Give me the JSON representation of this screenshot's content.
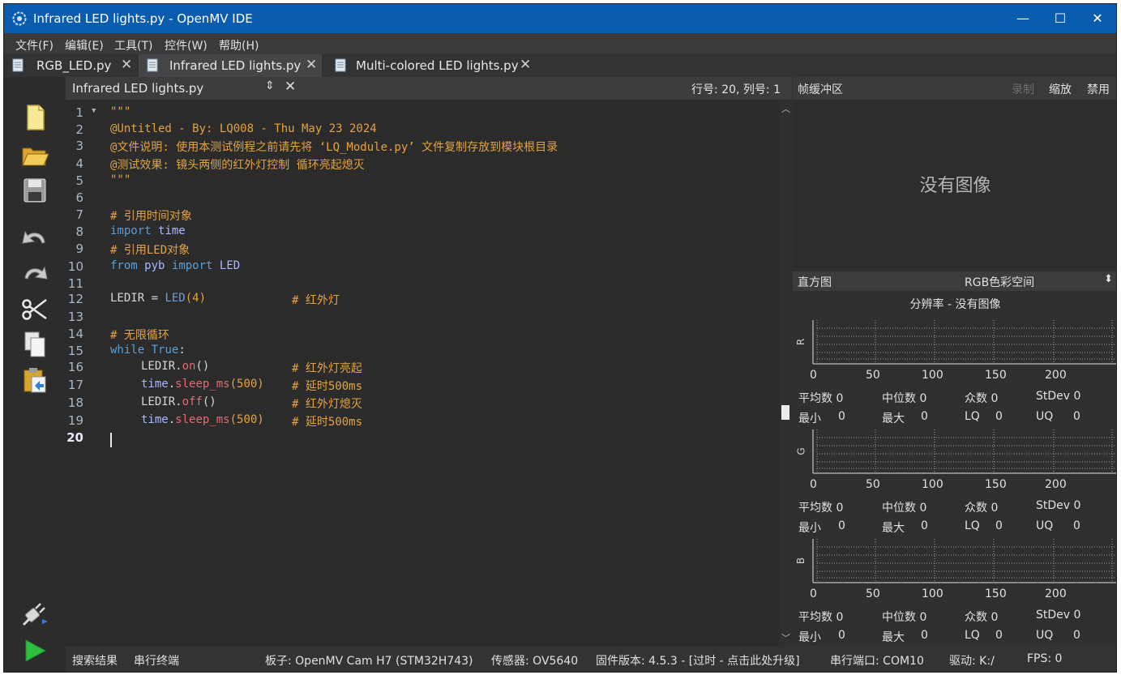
{
  "window": {
    "title": "Infrared LED lights.py - OpenMV IDE",
    "controls": {
      "minimize": "—",
      "maximize": "☐",
      "close": "✕"
    }
  },
  "menu": [
    "文件(F)",
    "编辑(E)",
    "工具(T)",
    "控件(W)",
    "帮助(H)"
  ],
  "tabs": [
    {
      "label": "RGB_LED.py",
      "close": "✕"
    },
    {
      "label": "Infrared LED lights.py",
      "close": "✕"
    },
    {
      "label": "Multi-colored LED lights.py",
      "close": "✕"
    }
  ],
  "editor_header": {
    "file": "Infrared LED lights.py",
    "updown": "⇕",
    "close": "✕",
    "position": "行号: 20, 列号: 1"
  },
  "code_lines": {
    "l1": "\"\"\"",
    "l2": "@Untitled - By: LQ008 - Thu May 23 2024",
    "l3": "@文件说明: 使用本测试例程之前请先将 ‘LQ_Module.py’ 文件复制存放到模块根目录",
    "l4": "@测试效果: 镜头两侧的红外灯控制 循环亮起熄灭",
    "l5": "\"\"\"",
    "l7": "# 引用时间对象",
    "l8_kw": "import",
    "l8_mod": "time",
    "l9": "# 引用LED对象",
    "l10_kw1": "from",
    "l10_mod": "pyb",
    "l10_kw2": "import",
    "l10_cls": "LED",
    "l12_var": "LEDIR = ",
    "l12_cls": "LED",
    "l12_arg": "(4)",
    "l12_cmt": "# 红外灯",
    "l14": "# 无限循环",
    "l15_kw": "while",
    "l15_val": "True",
    "l15_colon": ":",
    "l16_obj": "LEDIR.",
    "l16_fn": "on",
    "l16_paren": "()",
    "l16_cmt": "# 红外灯亮起",
    "l17_mod": "time",
    "l17_dot": ".",
    "l17_fn": "sleep_ms",
    "l17_arg": "(500)",
    "l17_cmt": "# 延时500ms",
    "l18_obj": "LEDIR.",
    "l18_fn": "off",
    "l18_paren": "()",
    "l18_cmt": "# 红外灯熄灭",
    "l19_mod": "time",
    "l19_dot": ".",
    "l19_fn": "sleep_ms",
    "l19_arg": "(500)",
    "l19_cmt": "# 延时500ms"
  },
  "line_numbers": [
    "1",
    "2",
    "3",
    "4",
    "5",
    "6",
    "7",
    "8",
    "9",
    "10",
    "11",
    "12",
    "13",
    "14",
    "15",
    "16",
    "17",
    "18",
    "19",
    "20"
  ],
  "framebuffer": {
    "title": "帧缓冲区",
    "record": "录制",
    "zoom": "缩放",
    "disable": "禁用",
    "no_image": "没有图像"
  },
  "histogram": {
    "title": "直方图",
    "colorspace": "RGB色彩空间",
    "resolution": "分辨率 - 没有图像",
    "ticks": [
      "0",
      "50",
      "100",
      "150",
      "200"
    ],
    "channels": [
      {
        "label": "R",
        "mean": "平均数 0",
        "median": "中位数 0",
        "mode": "众数 0",
        "stdev": "StDev 0",
        "min": "最小",
        "min_v": "0",
        "max": "最大",
        "max_v": "0",
        "lq": "LQ",
        "lq_v": "0",
        "uq": "UQ",
        "uq_v": "0"
      },
      {
        "label": "G",
        "mean": "平均数 0",
        "median": "中位数 0",
        "mode": "众数 0",
        "stdev": "StDev 0",
        "min": "最小",
        "min_v": "0",
        "max": "最大",
        "max_v": "0",
        "lq": "LQ",
        "lq_v": "0",
        "uq": "UQ",
        "uq_v": "0"
      },
      {
        "label": "B",
        "mean": "平均数 0",
        "median": "中位数 0",
        "mode": "众数 0",
        "stdev": "StDev 0",
        "min": "最小",
        "min_v": "0",
        "max": "最大",
        "max_v": "0",
        "lq": "LQ",
        "lq_v": "0",
        "uq": "UQ",
        "uq_v": "0"
      }
    ]
  },
  "status": {
    "search_results": "搜索结果",
    "serial_terminal": "串行终端",
    "board": "板子: OpenMV Cam H7 (STM32H743)",
    "sensor": "传感器: OV5640",
    "firmware": "固件版本: 4.5.3 - [过时 - 点击此处升级]",
    "serial_port": "串行端口: COM10",
    "drive": "驱动: K:/",
    "fps": "FPS: 0"
  },
  "toolbar_icons": [
    "new-file-icon",
    "open-folder-icon",
    "save-icon",
    "undo-icon",
    "redo-icon",
    "cut-icon",
    "copy-icon",
    "paste-icon",
    "connect-icon",
    "run-icon"
  ],
  "colors": {
    "titlebar": "#0a5cae",
    "comment": "#e3a340",
    "keyword": "#5a9fd6",
    "run": "#2fbf3f"
  }
}
